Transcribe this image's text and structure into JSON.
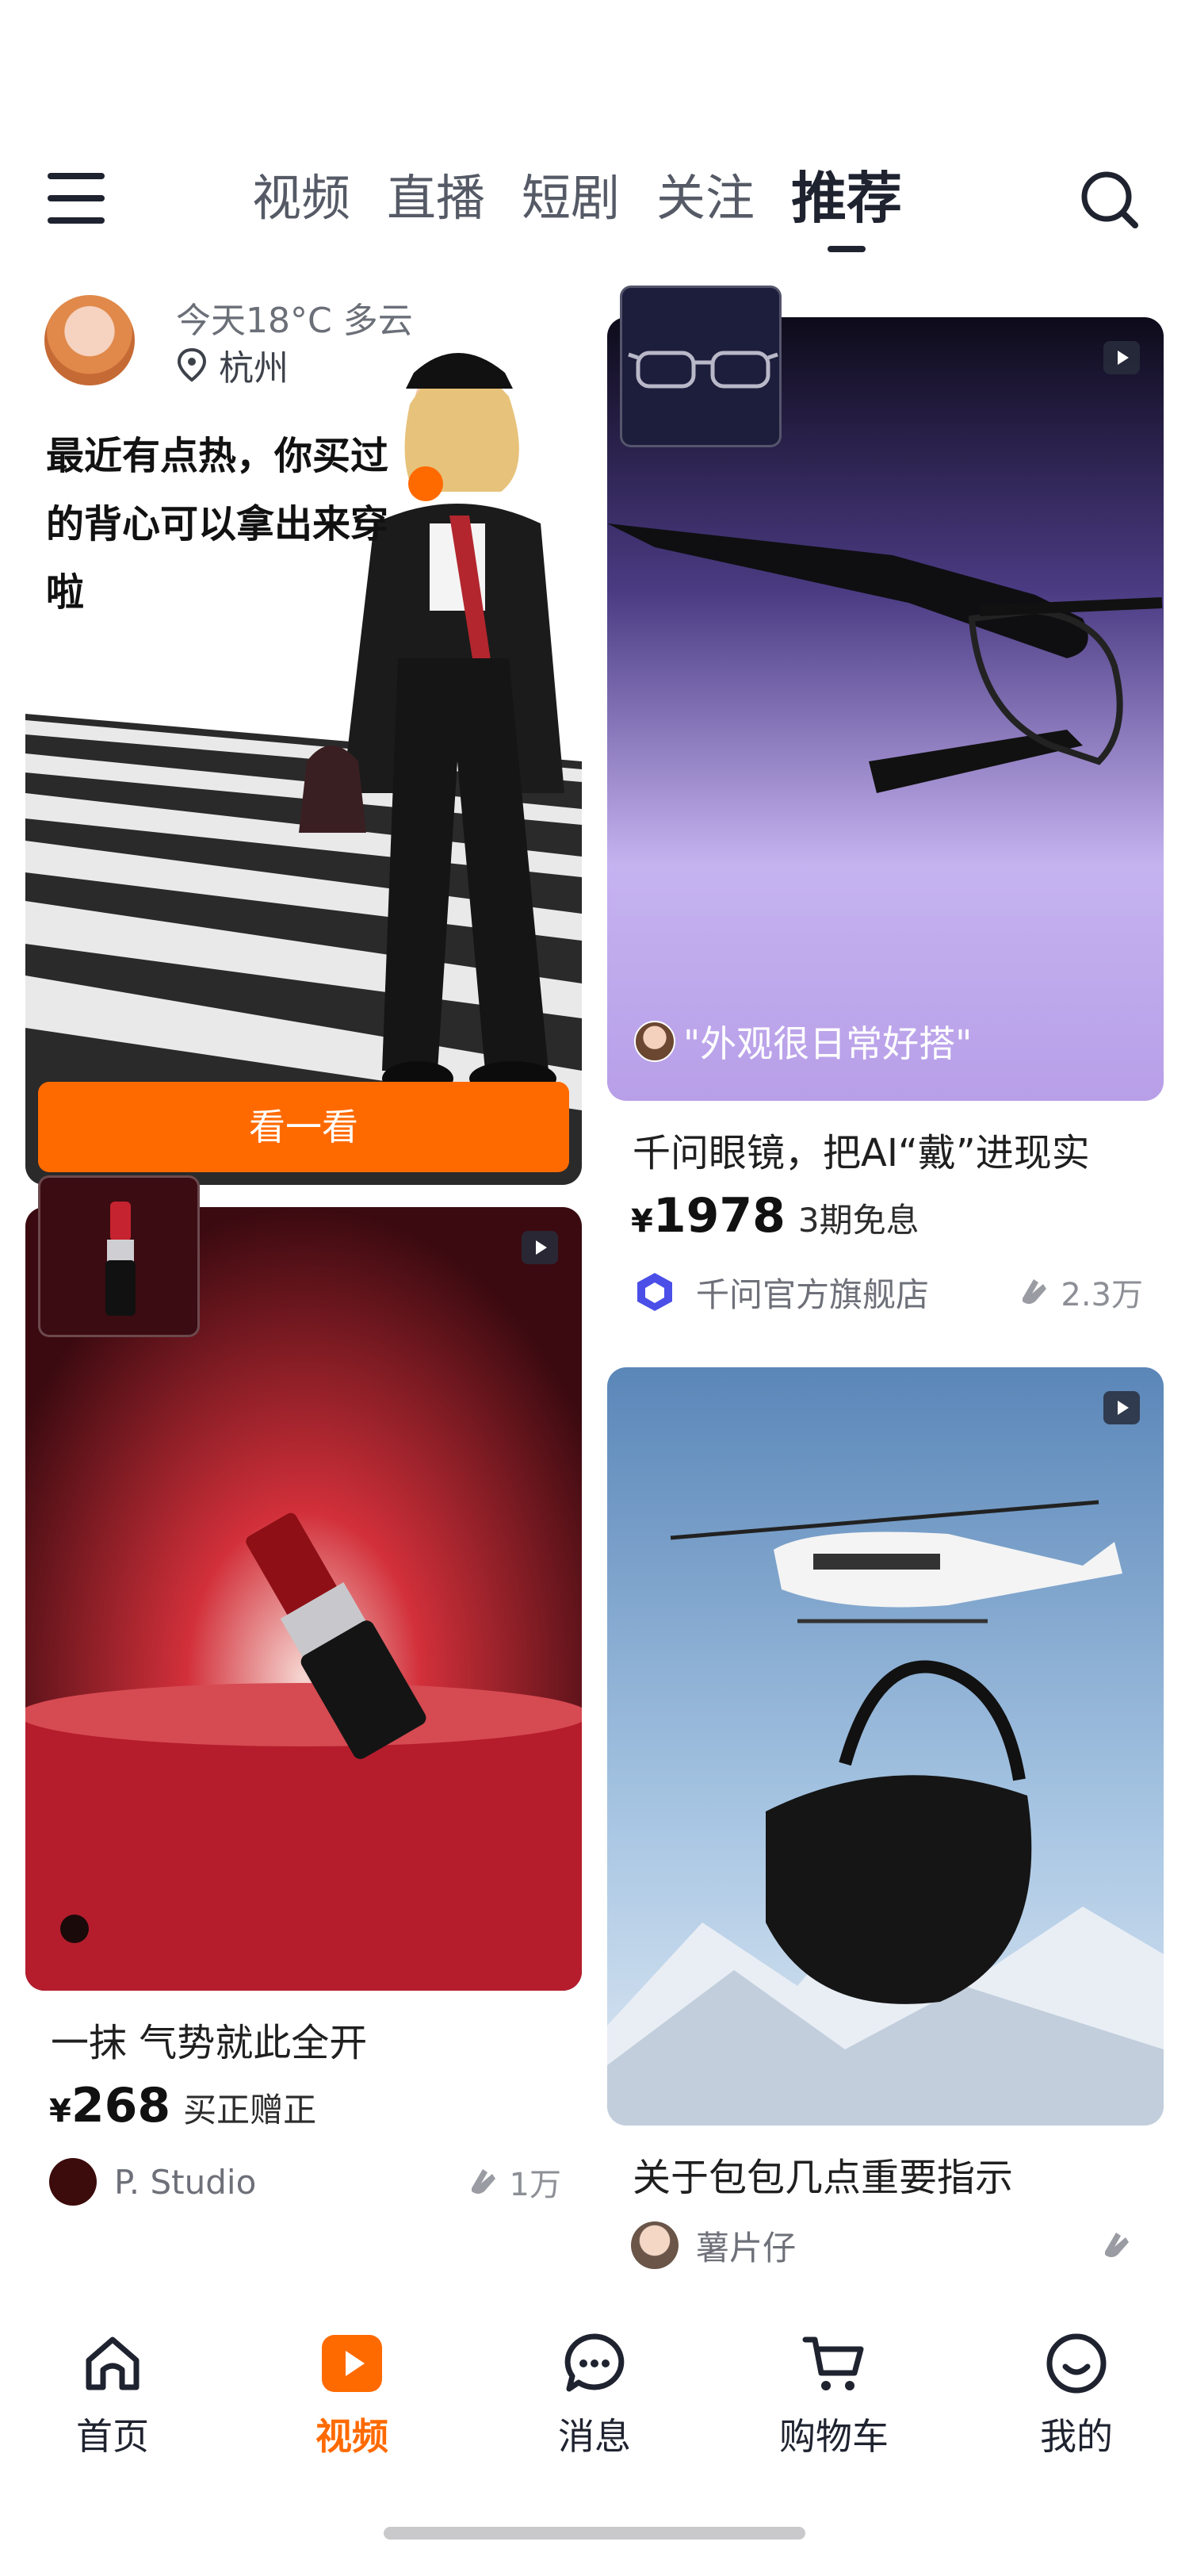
{
  "nav": {
    "tabs": [
      "视频",
      "直播",
      "短剧",
      "关注",
      "推荐"
    ],
    "active_tab": "推荐"
  },
  "weather_card": {
    "weather": "今天18°C 多云",
    "city": "杭州",
    "headline": "最近有点热，你买过的背心可以拿出来穿啦",
    "button": "看一看"
  },
  "cards": {
    "glasses": {
      "quote": "\"外观很日常好搭\"",
      "title": "千问眼镜，把AI“戴”进现实",
      "currency": "¥",
      "price": "1978",
      "price_note": "3期免息",
      "shop": "千问官方旗舰店",
      "likes": "2.3万"
    },
    "lipstick": {
      "title": "一抹 气势就此全开",
      "currency": "¥",
      "price": "268",
      "price_note": "买正赠正",
      "shop": "P. Studio",
      "likes": "1万"
    },
    "bag": {
      "title": "关于包包几点重要指示",
      "shop": "薯片仔",
      "likes": ""
    }
  },
  "bottom_bar": {
    "items": [
      "首页",
      "视频",
      "消息",
      "购物车",
      "我的"
    ],
    "active": "视频"
  },
  "colors": {
    "accent": "#ff6a00",
    "text_dark": "#1f2330",
    "text_muted": "#6e7079"
  }
}
